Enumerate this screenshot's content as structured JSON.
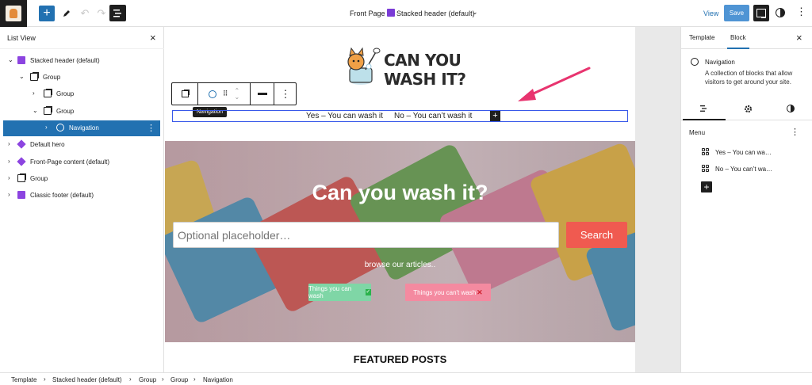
{
  "topbar": {
    "document_title": "Front Page",
    "template_name": "Stacked header (default)",
    "view_label": "View",
    "save_label": "Save",
    "add_symbol": "+",
    "undo_symbol": "↶",
    "redo_symbol": "↷",
    "more_symbol": "⋮",
    "chevron_symbol": "⌄"
  },
  "list_view": {
    "title": "List View",
    "close_symbol": "×",
    "items": [
      {
        "label": "Stacked header (default)",
        "icon": "template-part-icon",
        "chevron": "⌄"
      },
      {
        "label": "Group",
        "icon": "group-icon",
        "chevron": "⌄"
      },
      {
        "label": "Group",
        "icon": "group-icon",
        "chevron": "›"
      },
      {
        "label": "Group",
        "icon": "group-icon",
        "chevron": "⌄"
      },
      {
        "label": "Navigation",
        "icon": "navigation-icon",
        "chevron": "›"
      },
      {
        "label": "Default hero",
        "icon": "pattern-icon",
        "chevron": "›"
      },
      {
        "label": "Front-Page content (default)",
        "icon": "pattern-icon",
        "chevron": "›"
      },
      {
        "label": "Group",
        "icon": "group-icon",
        "chevron": "›"
      },
      {
        "label": "Classic footer (default)",
        "icon": "template-part-icon",
        "chevron": "›"
      }
    ]
  },
  "canvas": {
    "logo_line1": "CAN YOU",
    "logo_line2": "WASH IT?",
    "tooltip": "Navigation",
    "nav_items": [
      "Yes – You can wash it",
      "No – You can’t wash it"
    ],
    "nav_add_symbol": "+",
    "hero_title": "Can you wash it?",
    "search_placeholder": "Optional placeholder…",
    "search_button": "Search",
    "browse_text": "browse our articles..",
    "pill_can": "Things you can wash",
    "pill_cant": "Things you can't wash",
    "check_symbol": "✓",
    "cross_symbol": "✕",
    "featured": "FEATURED POSTS",
    "accent_colors": {
      "search_button": "#f05a50",
      "pill_can": "#7fd6a6",
      "pill_cant": "#f48aa0",
      "arrow": "#e8346f"
    }
  },
  "settings": {
    "tab_template": "Template",
    "tab_block": "Block",
    "close_symbol": "×",
    "block_name": "Navigation",
    "block_description": "A collection of blocks that allow visitors to get around your site.",
    "menu_label": "Menu",
    "menu_items": [
      "Yes – You can wa…",
      "No – You can’t wa…"
    ],
    "add_symbol": "+",
    "kebab_symbol": "⋮"
  },
  "breadcrumb": [
    "Template",
    "Stacked header (default)",
    "Group",
    "Group",
    "Navigation"
  ],
  "breadcrumb_sep": "›"
}
